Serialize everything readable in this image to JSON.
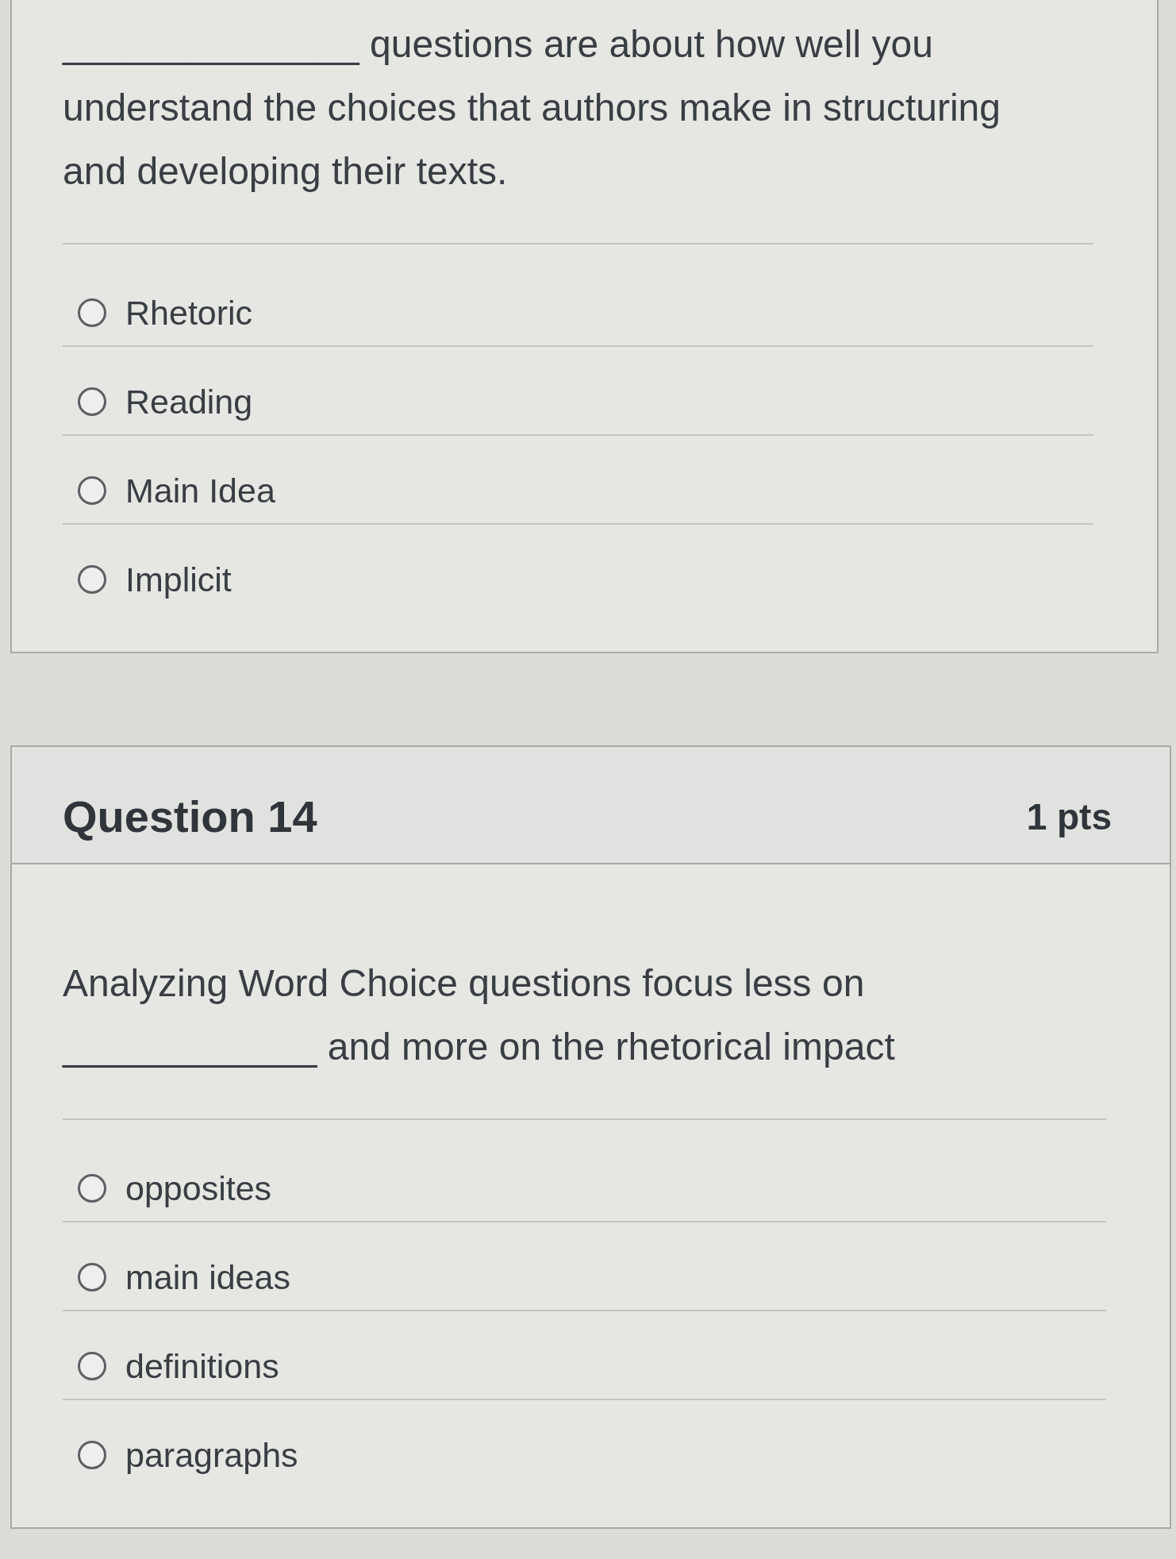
{
  "questions": [
    {
      "prompt": "______________ questions are about how well you understand the choices that authors make in structuring and developing their texts.",
      "answers": [
        {
          "label": "Rhetoric",
          "selected": false
        },
        {
          "label": "Reading",
          "selected": false
        },
        {
          "label": "Main Idea",
          "selected": false
        },
        {
          "label": "Implicit",
          "selected": false
        }
      ]
    },
    {
      "title": "Question 14",
      "points": "1 pts",
      "prompt": "Analyzing Word Choice questions focus less on ____________ and more on the rhetorical impact",
      "answers": [
        {
          "label": "opposites",
          "selected": false
        },
        {
          "label": "main ideas",
          "selected": false
        },
        {
          "label": "definitions",
          "selected": false
        },
        {
          "label": "paragraphs",
          "selected": false
        }
      ]
    }
  ]
}
